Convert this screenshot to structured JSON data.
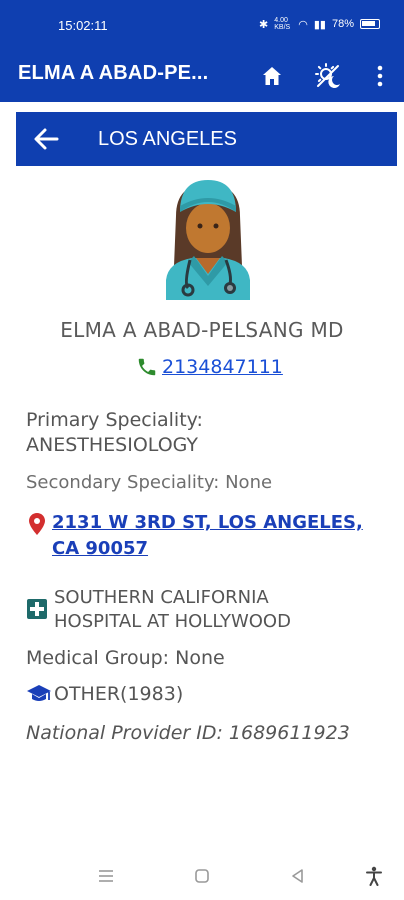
{
  "status": {
    "time": "15:02:11",
    "speed": "4.00 KB/S",
    "battery": "78%"
  },
  "appbar": {
    "title": "ELMA A ABAD-PE...",
    "icons": [
      "home-icon",
      "theme-toggle-icon",
      "more-vert-icon"
    ]
  },
  "location": {
    "title": "LOS ANGELES"
  },
  "doctor": {
    "name": "ELMA A ABAD-PELSANG MD",
    "phone": "2134847111",
    "primary_label": "Primary Speciality:",
    "primary_value": "ANESTHESIOLOGY",
    "secondary": "Secondary Speciality: None",
    "address_line1": "2131 W 3RD ST, LOS ANGELES,",
    "address_line2": "CA 90057",
    "hospital_line1": "SOUTHERN CALIFORNIA",
    "hospital_line2": "HOSPITAL AT HOLLYWOOD",
    "medical_group": "Medical Group: None",
    "education": "OTHER(1983)",
    "npi": "National Provider ID: 1689611923"
  },
  "colors": {
    "primary": "#0f3fb0",
    "link": "#1a4fd6",
    "phone_icon": "#2e8b2e",
    "location_icon": "#d32f2f",
    "hospital_icon": "#1e6a6a",
    "education_icon": "#1a3fb8"
  }
}
